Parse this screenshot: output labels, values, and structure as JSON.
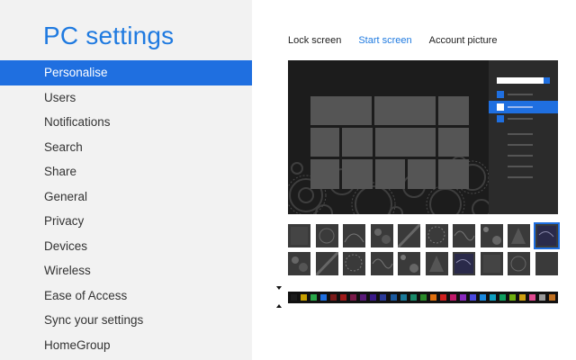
{
  "app": {
    "title": "PC settings"
  },
  "nav": {
    "items": [
      {
        "label": "Personalise",
        "active": true
      },
      {
        "label": "Users"
      },
      {
        "label": "Notifications"
      },
      {
        "label": "Search"
      },
      {
        "label": "Share"
      },
      {
        "label": "General"
      },
      {
        "label": "Privacy"
      },
      {
        "label": "Devices"
      },
      {
        "label": "Wireless"
      },
      {
        "label": "Ease of Access"
      },
      {
        "label": "Sync your settings"
      },
      {
        "label": "HomeGroup"
      }
    ]
  },
  "tabs": [
    {
      "label": "Lock screen"
    },
    {
      "label": "Start screen",
      "active": true
    },
    {
      "label": "Account picture"
    }
  ],
  "colors": {
    "accent": "#1f6fe0",
    "sidebar_bg": "#f2f2f2",
    "preview_bg": "#1c1c1c",
    "tile": "#555555"
  },
  "palette": [
    "#1c1c1c",
    "#c8a000",
    "#2aa84a",
    "#1f6fe0",
    "#7a1a1a",
    "#a01a1a",
    "#7a1a4a",
    "#5a1a7a",
    "#3a1a8a",
    "#2a3a9a",
    "#1a5aa0",
    "#1a7a9a",
    "#1a8a6a",
    "#2a8a2a",
    "#e07010",
    "#d02020",
    "#c01a6a",
    "#8a2ac0",
    "#4a4ae0",
    "#1a8ae0",
    "#10a0c0",
    "#10a060",
    "#70b010",
    "#d0a010",
    "#e04a90",
    "#9a9a9a",
    "#c07020"
  ]
}
